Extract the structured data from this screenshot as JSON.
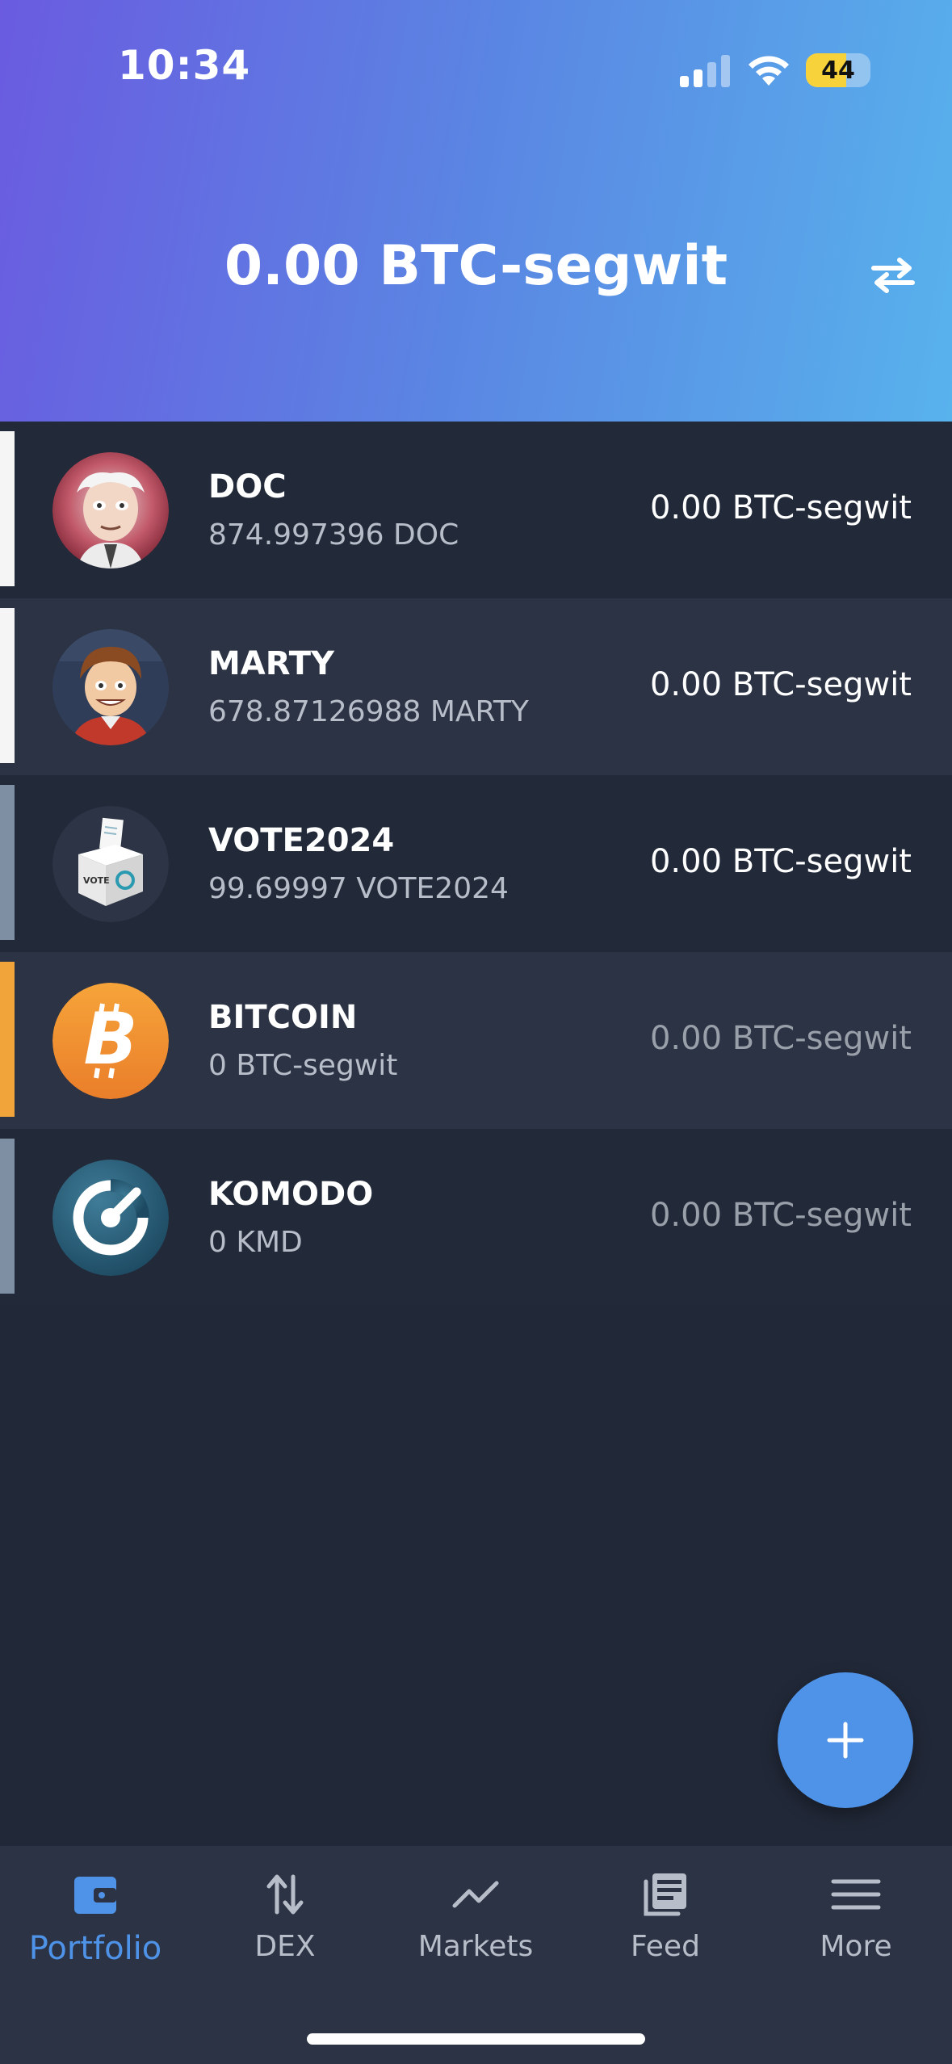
{
  "status_bar": {
    "time": "10:34",
    "battery": "44"
  },
  "header": {
    "total": "0.00 BTC-segwit"
  },
  "coins": [
    {
      "name": "DOC",
      "balance": "874.997396 DOC",
      "value": "0.00 BTC-segwit",
      "bar_color": "#f5f5f5",
      "value_dim": false
    },
    {
      "name": "MARTY",
      "balance": "678.87126988 MARTY",
      "value": "0.00 BTC-segwit",
      "bar_color": "#f5f5f5",
      "value_dim": false
    },
    {
      "name": "VOTE2024",
      "balance": "99.69997 VOTE2024",
      "value": "0.00 BTC-segwit",
      "bar_color": "#7e8ea3",
      "value_dim": false
    },
    {
      "name": "BITCOIN",
      "balance": "0 BTC-segwit",
      "value": "0.00 BTC-segwit",
      "bar_color": "#f0a43a",
      "value_dim": true
    },
    {
      "name": "KOMODO",
      "balance": "0 KMD",
      "value": "0.00 BTC-segwit",
      "bar_color": "#7e8ea3",
      "value_dim": true
    }
  ],
  "tabs": [
    {
      "label": "Portfolio",
      "icon": "wallet-icon",
      "active": true
    },
    {
      "label": "DEX",
      "icon": "swap-arrows-icon",
      "active": false
    },
    {
      "label": "Markets",
      "icon": "chart-line-icon",
      "active": false
    },
    {
      "label": "Feed",
      "icon": "news-icon",
      "active": false
    },
    {
      "label": "More",
      "icon": "menu-icon",
      "active": false
    }
  ],
  "colors": {
    "accent": "#4f93e8",
    "background": "#212837"
  }
}
